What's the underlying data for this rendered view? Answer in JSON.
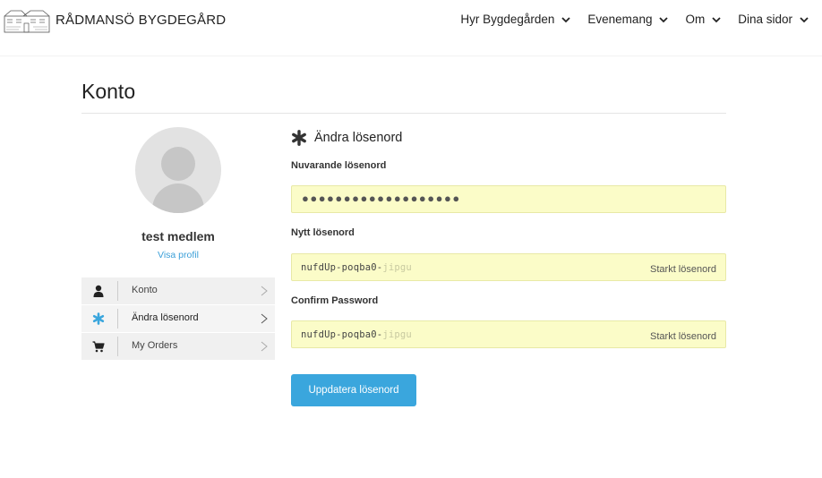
{
  "header": {
    "site_title": "RÅDMANSÖ BYGDEGÅRD",
    "nav": [
      {
        "label": "Hyr Bygdegården"
      },
      {
        "label": "Evenemang"
      },
      {
        "label": "Om"
      },
      {
        "label": "Dina sidor"
      }
    ]
  },
  "page": {
    "title": "Konto"
  },
  "profile": {
    "name": "test medlem",
    "link": "Visa profil"
  },
  "menu": [
    {
      "label": "Konto",
      "icon": "user-icon"
    },
    {
      "label": "Ändra lösenord",
      "icon": "asterisk-icon",
      "active": true
    },
    {
      "label": "My Orders",
      "icon": "cart-icon"
    }
  ],
  "form": {
    "section_title": "Ändra lösenord",
    "current": {
      "label": "Nuvarande lösenord",
      "masked_value": "●●●●●●●●●●●●●●●●●●●"
    },
    "new": {
      "label": "Nytt lösenord",
      "value": "nufdUp-poqba0-",
      "value_faded": "jipgu",
      "strength": "Starkt lösenord"
    },
    "confirm": {
      "label": "Confirm Password",
      "value": "nufdUp-poqba0-",
      "value_faded": "jipgu",
      "strength": "Starkt lösenord"
    },
    "submit": "Uppdatera lösenord"
  },
  "colors": {
    "accent": "#3aa6dd",
    "field_bg": "#fbfcc8",
    "menu_bg": "#f0f0f0"
  }
}
